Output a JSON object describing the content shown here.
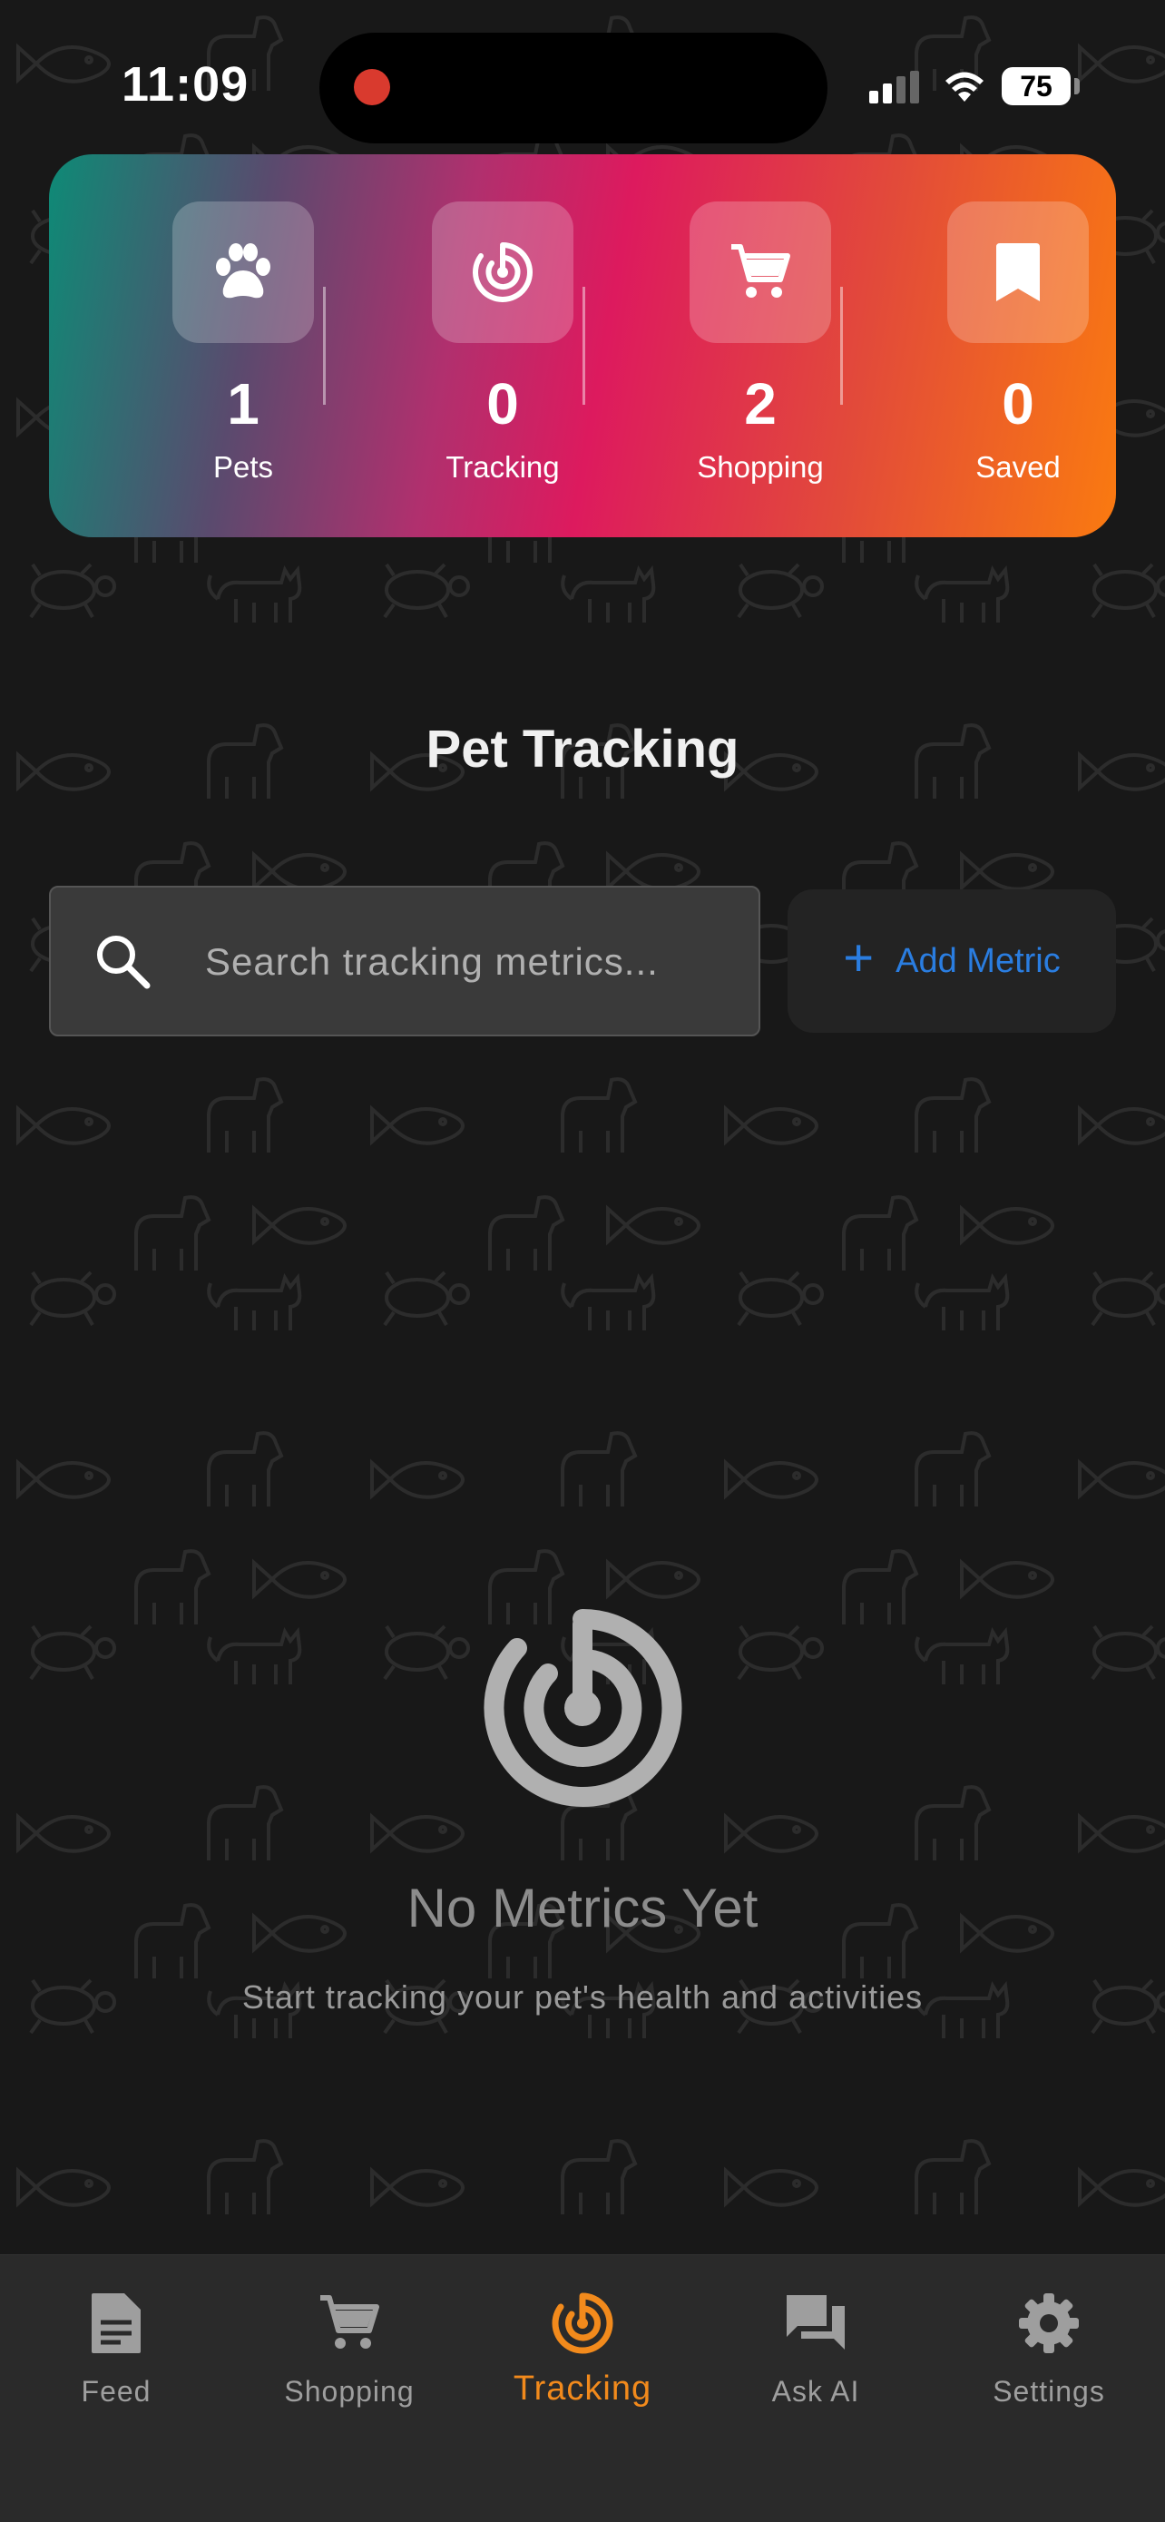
{
  "status_bar": {
    "time": "11:09",
    "battery": "75"
  },
  "stats": [
    {
      "value": "1",
      "label": "Pets",
      "icon": "paw-icon"
    },
    {
      "value": "0",
      "label": "Tracking",
      "icon": "tracking-icon"
    },
    {
      "value": "2",
      "label": "Shopping",
      "icon": "cart-icon"
    },
    {
      "value": "0",
      "label": "Saved",
      "icon": "bookmark-icon"
    }
  ],
  "page": {
    "title": "Pet Tracking"
  },
  "search": {
    "placeholder": "Search tracking metrics..."
  },
  "add_metric": {
    "label": "Add Metric"
  },
  "empty_state": {
    "title": "No Metrics Yet",
    "subtitle": "Start tracking your pet's health and activities"
  },
  "tabs": [
    {
      "label": "Feed",
      "icon": "document-icon",
      "active": false
    },
    {
      "label": "Shopping",
      "icon": "cart-icon",
      "active": false
    },
    {
      "label": "Tracking",
      "icon": "tracking-icon",
      "active": true
    },
    {
      "label": "Ask AI",
      "icon": "chat-icon",
      "active": false
    },
    {
      "label": "Settings",
      "icon": "gear-icon",
      "active": false
    }
  ],
  "colors": {
    "accent": "#f28a1c",
    "link": "#2a7de0",
    "background": "#181818"
  }
}
